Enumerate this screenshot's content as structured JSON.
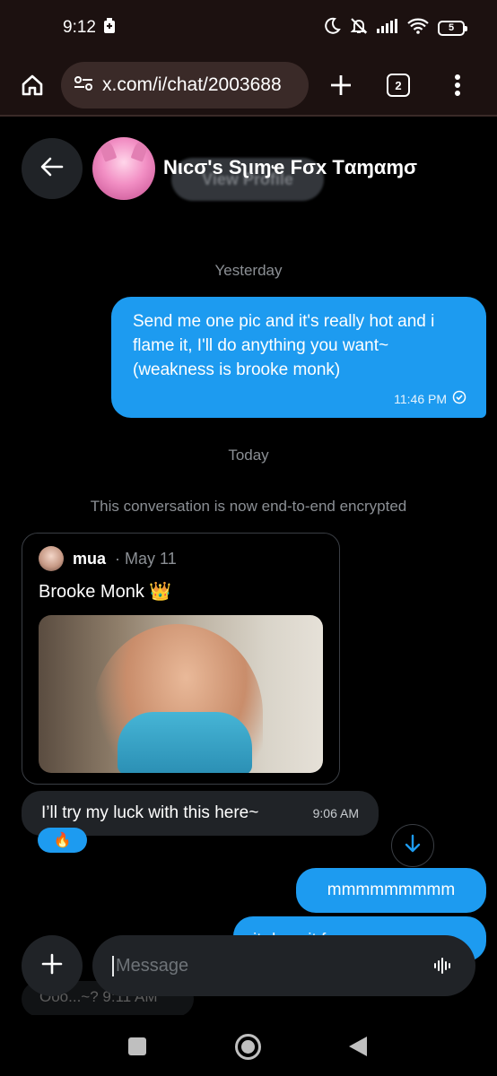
{
  "status_bar": {
    "time": "9:12",
    "battery": "5"
  },
  "browser": {
    "url": "x.com/i/chat/2003688",
    "tab_count": "2"
  },
  "chat": {
    "name": "Nιcσ's Sʅιɱҽ Fσx Tαɱαɱσ",
    "view_profile_label": "View Profile"
  },
  "messages": {
    "day_yesterday": "Yesterday",
    "msg1_text": "Send me one pic and it's really hot and i flame it, I'll do anything you want~ (weakness is brooke monk)",
    "msg1_time": "11:46 PM",
    "day_today": "Today",
    "encryption_notice": "This conversation is now end-to-end encrypted",
    "quote_user": "mua",
    "quote_date": "· May 11",
    "quote_text": "Brooke Monk 👑",
    "msg_in1_text": "I’ll try my luck with this here~",
    "msg_in1_time": "9:06 AM",
    "reaction": "🔥",
    "msg_out2_text": "mmmmmmmmm",
    "msg_out3_text": "it does it for me...",
    "ghost_text": "Ooo...~?  9:11 AM"
  },
  "composer": {
    "placeholder": "Message"
  }
}
